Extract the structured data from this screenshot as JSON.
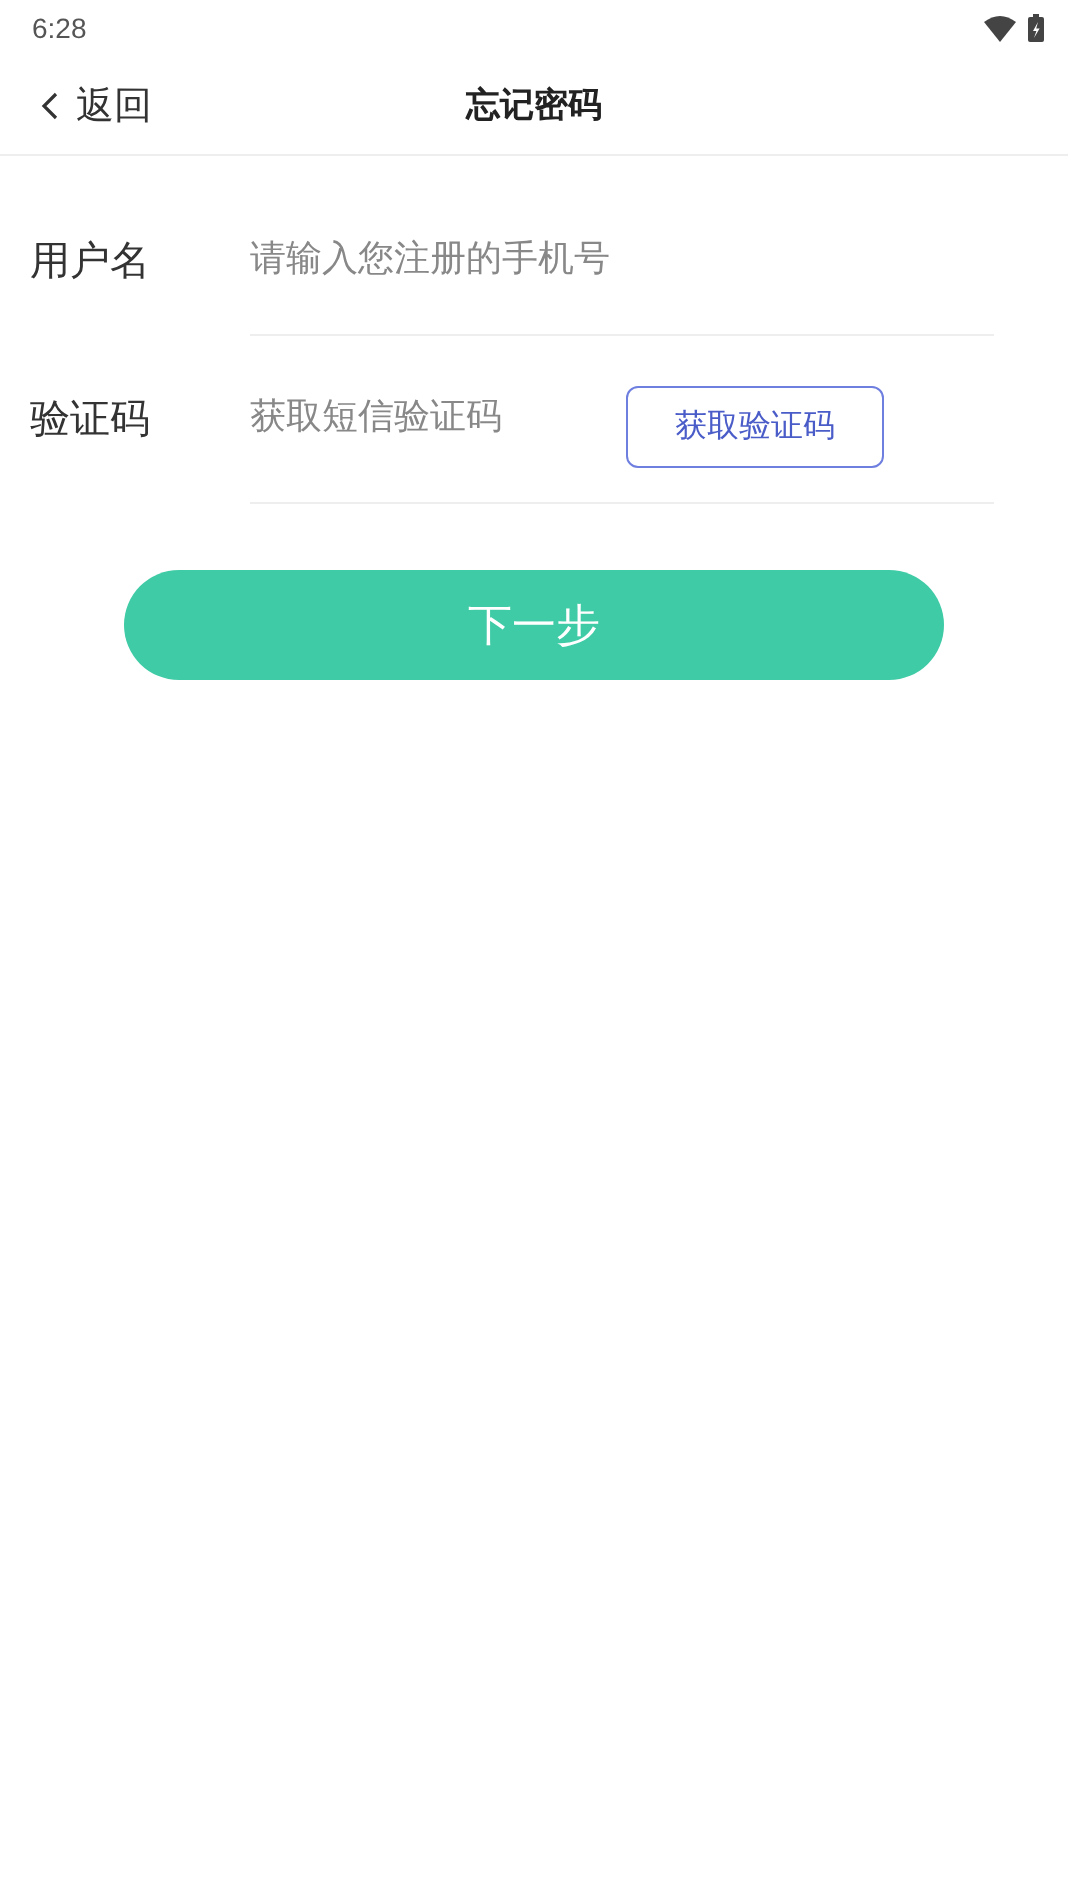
{
  "status_bar": {
    "time": "6:28"
  },
  "header": {
    "back_label": "返回",
    "title": "忘记密码"
  },
  "form": {
    "fields": [
      {
        "label": "用户名",
        "placeholder": "请输入您注册的手机号",
        "kind": "text"
      },
      {
        "label": "验证码",
        "placeholder": "获取短信验证码",
        "kind": "code",
        "action": "获取验证码"
      }
    ]
  },
  "submit": "下一步"
}
